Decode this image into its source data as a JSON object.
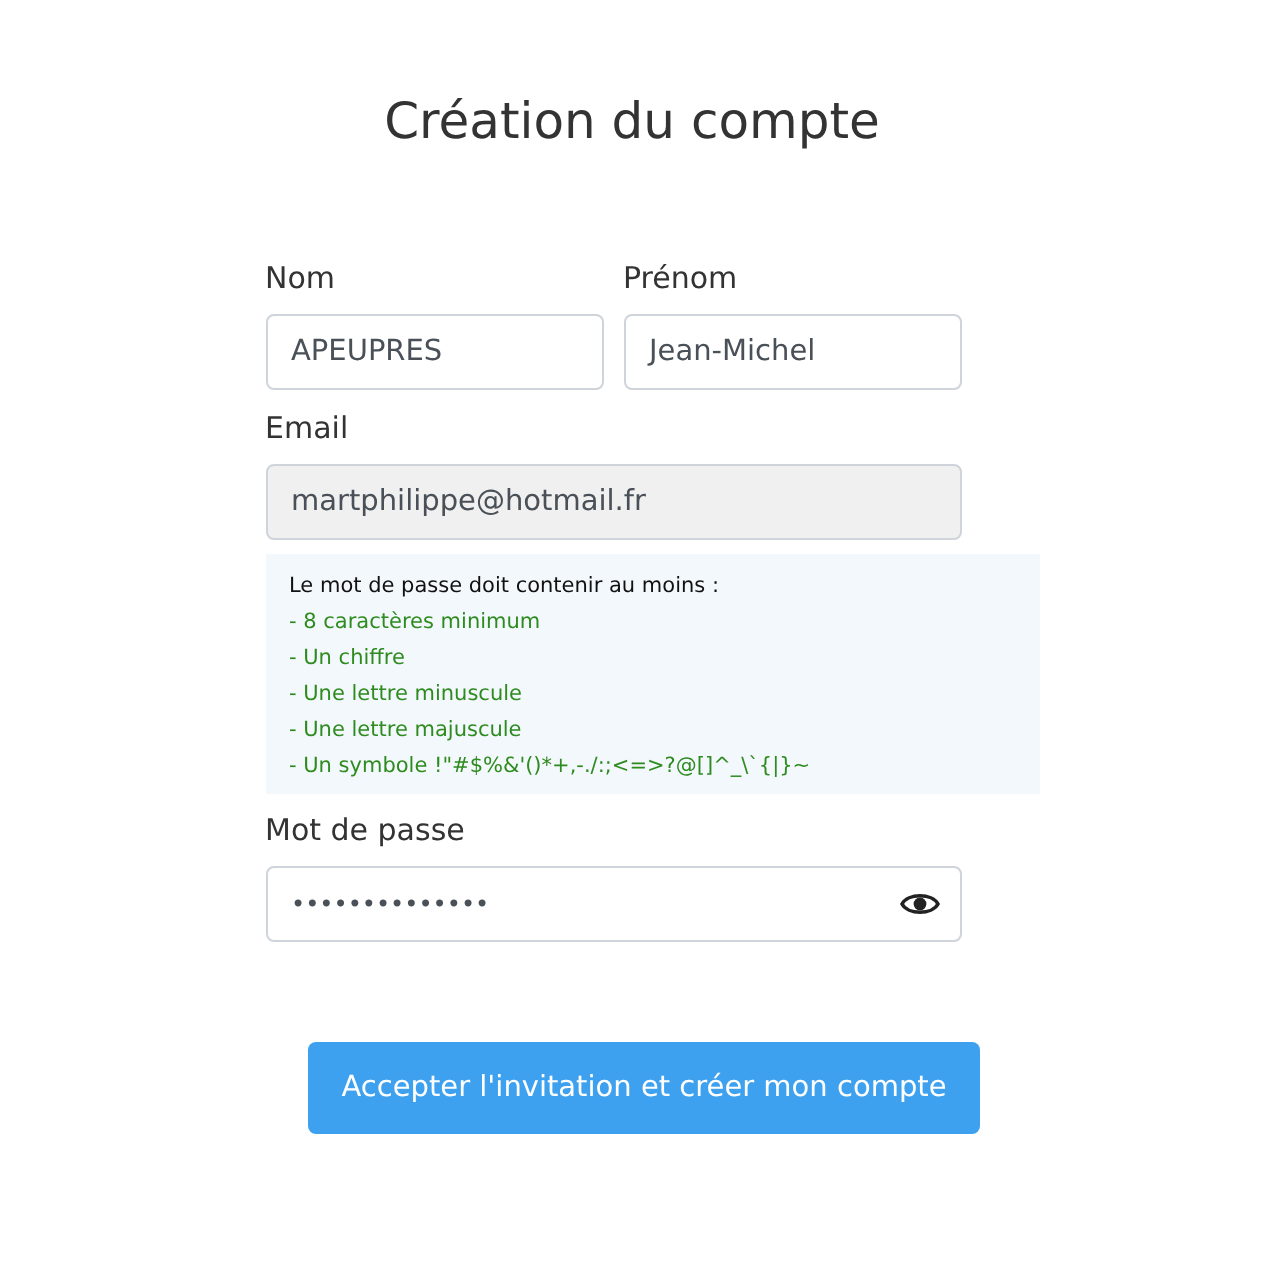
{
  "title": "Création du compte",
  "fields": [
    {
      "label": "Nom",
      "value": "APEUPRES",
      "disabled": false
    },
    {
      "label": "Prénom",
      "value": "Jean-Michel",
      "disabled": false
    }
  ],
  "email": {
    "label": "Email",
    "value": "martphilippe@hotmail.fr",
    "disabled": true
  },
  "password_rules": {
    "heading": "Le mot de passe doit contenir au moins :",
    "items": [
      {
        "text": "- 8 caractères minimum",
        "met": true
      },
      {
        "text": "- Un chiffre",
        "met": true
      },
      {
        "text": "- Une lettre minuscule",
        "met": true
      },
      {
        "text": "- Une lettre majuscule",
        "met": true
      },
      {
        "text": "- Un symbole !\"#$%&'()*+,-./:;<=>?@[]^_\\`{|}~",
        "met": true
      }
    ]
  },
  "password": {
    "label": "Mot de passe",
    "value": "••••••••••••••"
  },
  "submit": "Accepter l'invitation et créer mon compte"
}
